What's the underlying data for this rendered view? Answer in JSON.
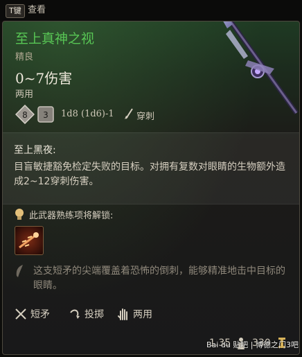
{
  "hotkey": {
    "key": "T键",
    "action": "查看"
  },
  "item": {
    "name": "至上真神之视",
    "rarity": "精良",
    "damage": "0~7伤害",
    "handedness": "两用",
    "dice": {
      "die_faces": [
        "8",
        "3"
      ],
      "formula": "1d8 (1d6)-1",
      "damage_type": "穿刺"
    }
  },
  "passive": {
    "name": "至上黑夜:",
    "description": "目盲敏捷豁免检定失败的目标。对拥有复数对眼睛的生物额外造成2~12穿刺伤害。"
  },
  "proficiency": {
    "label": "此武器熟练项将解锁:"
  },
  "flavor": "这支短矛的尖端覆盖着恐怖的倒刺，能够精准地击中目标的眼睛。",
  "properties": [
    {
      "label": "短矛",
      "icon": "spear-icon"
    },
    {
      "label": "投掷",
      "icon": "throw-icon"
    },
    {
      "label": "两用",
      "icon": "hand-icon"
    }
  ],
  "footer": {
    "weight": "1.35",
    "price": "330"
  },
  "watermark": "Bai du 贴吧 | 博德之门3吧",
  "colors": {
    "title": "#58c655",
    "panel_top": "#1f3a23",
    "text": "#d6cfc0",
    "flavor": "#8f887b"
  }
}
